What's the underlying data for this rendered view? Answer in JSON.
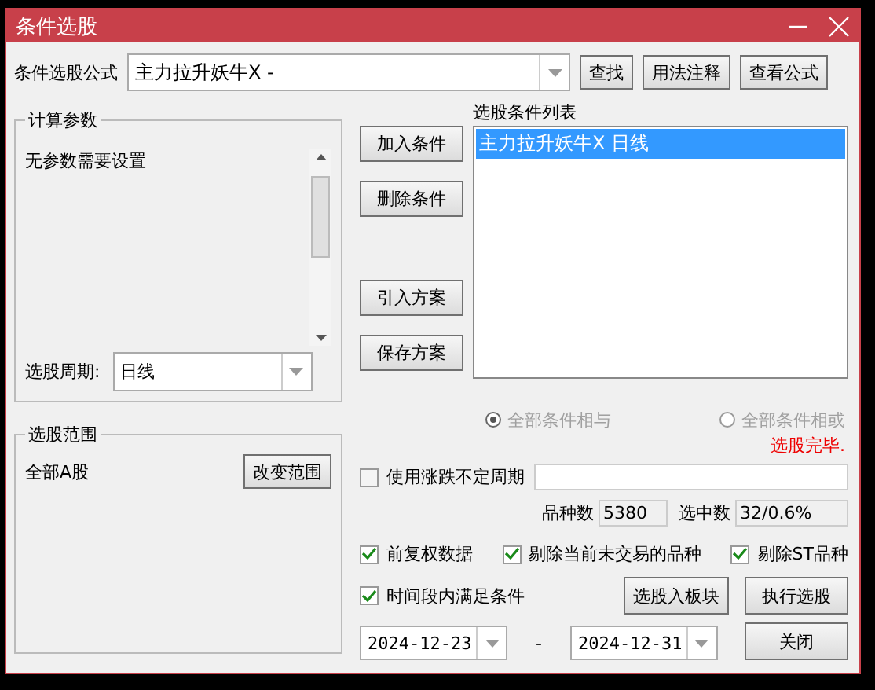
{
  "window": {
    "title": "条件选股"
  },
  "formula": {
    "label": "条件选股公式",
    "value": "主力拉升妖牛X -",
    "buttons": [
      "查找",
      "用法注释",
      "查看公式"
    ]
  },
  "params": {
    "title": "计算参数",
    "message": "无参数需要设置",
    "period_label": "选股周期:",
    "period_value": "日线"
  },
  "condition_buttons": [
    [
      "加入条件",
      "删除条件"
    ],
    [
      "引入方案",
      "保存方案"
    ]
  ],
  "condition_list": {
    "title": "选股条件列表",
    "items": [
      {
        "text": "主力拉升妖牛X  日线",
        "selected": true
      }
    ]
  },
  "logic": [
    {
      "label": "全部条件相与",
      "selected": true,
      "disabled": true
    },
    {
      "label": "全部条件相或",
      "selected": false,
      "disabled": true
    }
  ],
  "status": "选股完毕.",
  "range": {
    "title": "选股范围",
    "value": "全部A股",
    "button": "改变范围"
  },
  "variable_period": {
    "label": "使用涨跌不定周期",
    "checked": false
  },
  "stats": [
    {
      "label": "品种数",
      "value": "5380"
    },
    {
      "label": "选中数",
      "value": "32/0.6%"
    }
  ],
  "options": [
    {
      "label": "前复权数据",
      "checked": true
    },
    {
      "label": "剔除当前未交易的品种",
      "checked": true
    },
    {
      "label": "剔除ST品种",
      "checked": true
    }
  ],
  "time_range": {
    "label": "时间段内满足条件",
    "checked": true,
    "start": "2024-12-23",
    "separator": "-",
    "end": "2024-12-31"
  },
  "action_buttons": [
    "选股入板块",
    "执行选股",
    "关闭"
  ]
}
